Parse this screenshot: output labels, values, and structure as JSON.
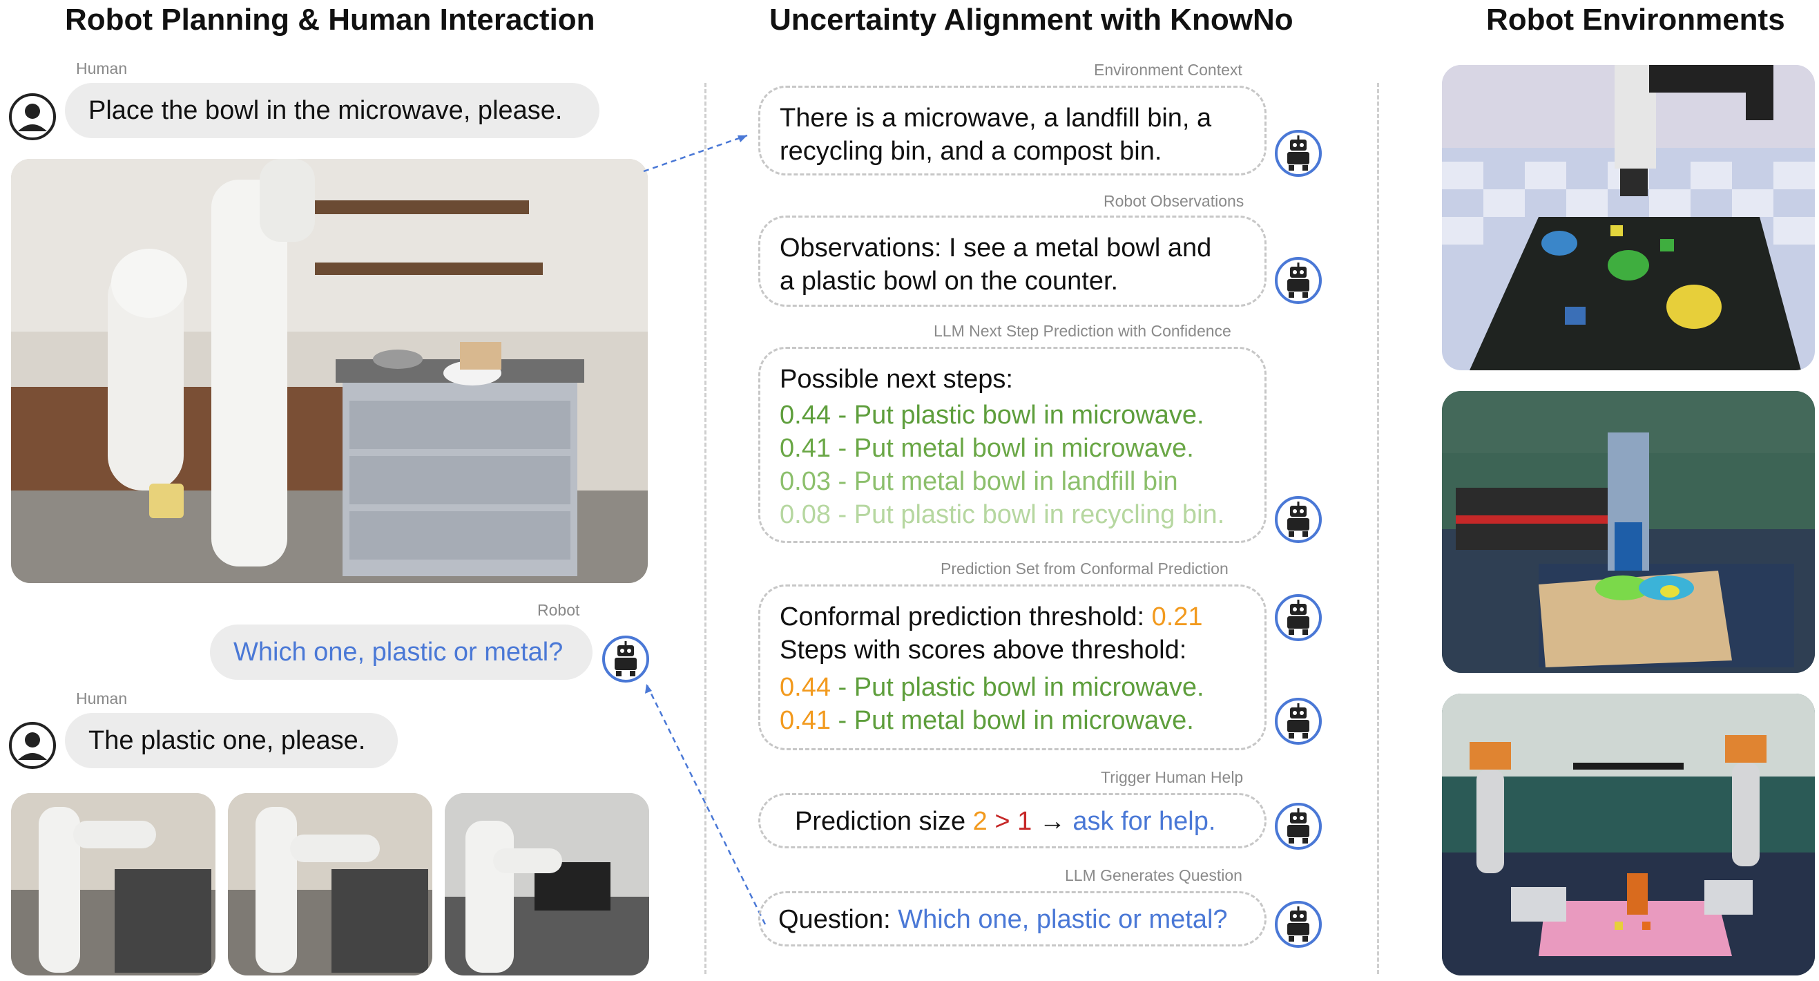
{
  "titles": {
    "left": "Robot Planning & Human Interaction",
    "middle": "Uncertainty Alignment with KnowNo",
    "right": "Robot Environments"
  },
  "chat": {
    "human_label_1": "Human",
    "human_msg_1": "Place the bowl in the microwave, please.",
    "robot_label": "Robot",
    "robot_msg": "Which one, plastic or metal?",
    "human_label_2": "Human",
    "human_msg_2": "The plastic one, please."
  },
  "steps": {
    "env_label": "Environment Context",
    "env_line1": "There is a microwave, a landfill bin, a",
    "env_line2": "recycling bin, and a compost bin.",
    "obs_label": "Robot Observations",
    "obs_line1": "Observations: I see a metal bowl and",
    "obs_line2": "a plastic bowl on the counter.",
    "pred_label": "LLM Next Step Prediction with Confidence",
    "pred_header": "Possible next steps:",
    "pred_options": [
      "0.44 - Put plastic bowl in microwave.",
      "0.41 - Put metal bowl in microwave.",
      "0.03 - Put metal bowl in landfill bin",
      "0.08 - Put plastic bowl in recycling bin."
    ],
    "cp_label": "Prediction Set from Conformal Prediction",
    "cp_threshold_text": "Conformal prediction threshold: ",
    "cp_threshold_value": "0.21",
    "cp_steps_header": "Steps with scores above threshold:",
    "cp_set": [
      {
        "score": "0.44",
        "text": " - Put plastic bowl in microwave."
      },
      {
        "score": "0.41",
        "text": " - Put metal bowl in microwave."
      }
    ],
    "trigger_label": "Trigger Human Help",
    "trigger_prefix": "Prediction size ",
    "trigger_size": "2",
    "trigger_gt": " > ",
    "trigger_one": "1",
    "trigger_arrow": " → ",
    "trigger_help": "ask for help.",
    "question_label": "LLM Generates Question",
    "question_prefix": "Question: ",
    "question_text": "Which one, plastic or metal?"
  },
  "colors": {
    "accent_blue": "#4a78d6",
    "orange": "#f29a1e",
    "red": "#c62828",
    "green_dark": "#5e9e3c",
    "green_light": "#b6d7a0"
  },
  "icons": {
    "human": "person-icon",
    "robot": "robot-icon"
  }
}
